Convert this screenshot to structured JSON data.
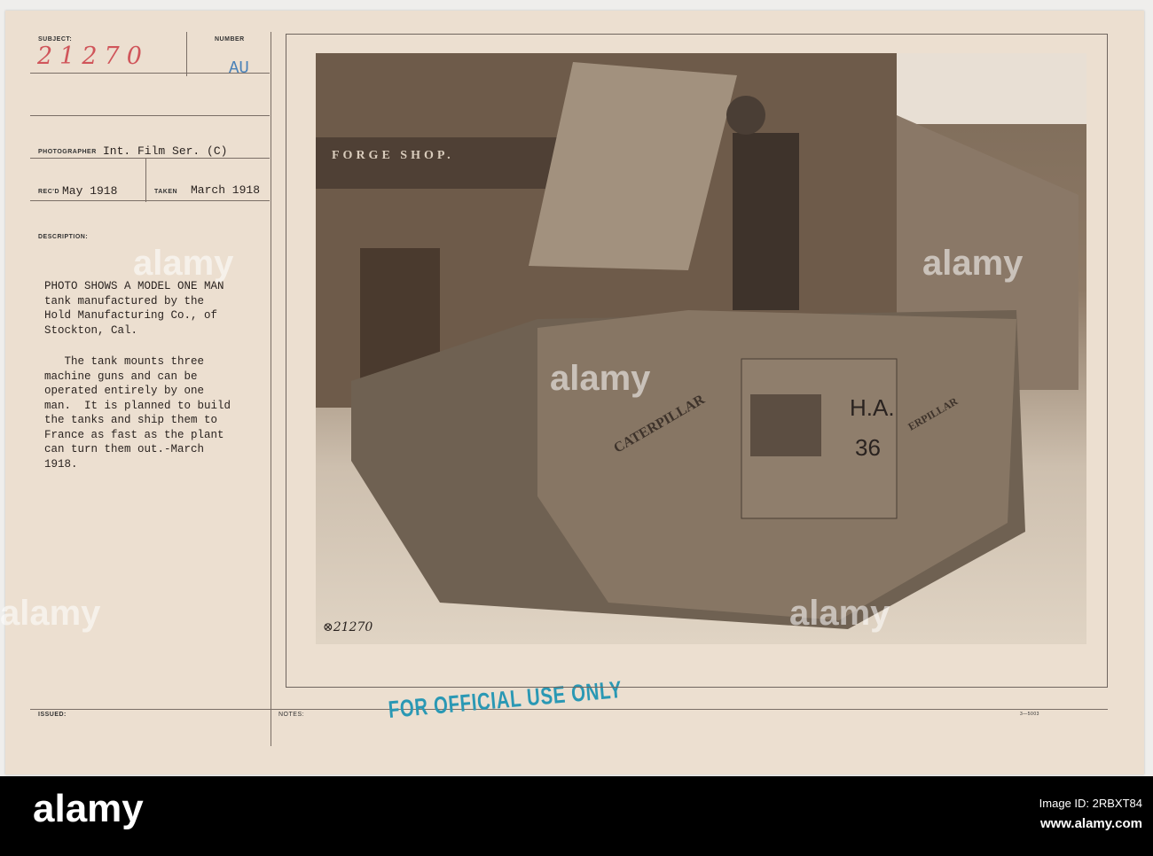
{
  "card": {
    "subject_label": "SUBJECT:",
    "subject_value": "21270",
    "number_label": "NUMBER",
    "number_value": "AU",
    "photographer_label": "PHOTOGRAPHER",
    "photographer_value": "Int. Film Ser. (C)",
    "recd_label": "REC'D",
    "recd_value": "May 1918",
    "taken_label": "TAKEN",
    "taken_value": "March 1918",
    "description_label": "DESCRIPTION:",
    "description_p1": "PHOTO SHOWS A MODEL ONE MAN\ntank manufactured by the\nHold Manufacturing Co., of\nStockton, Cal.",
    "description_p2": "   The tank mounts three\nmachine guns and can be\noperated entirely by one\nman.  It is planned to build\nthe tanks and ship them to\nFrance as fast as the plant\ncan turn them out.-March\n1918.",
    "issued_label": "ISSUED:",
    "notes_label": "NOTES:",
    "form_code": "3—5003",
    "stamp": "FOR OFFICIAL USE ONLY"
  },
  "photo": {
    "sign": "FORGE SHOP.",
    "tank_text": "CATERPILLAR",
    "tank_text2": "ERPILLAR",
    "tank_marking_1": "H.A.",
    "tank_marking_2": "36",
    "negative_number": "⊗21270"
  },
  "watermark": "alamy",
  "footer": {
    "logo": "alamy",
    "image_id": "Image ID: 2RBXT84",
    "url": "www.alamy.com"
  }
}
